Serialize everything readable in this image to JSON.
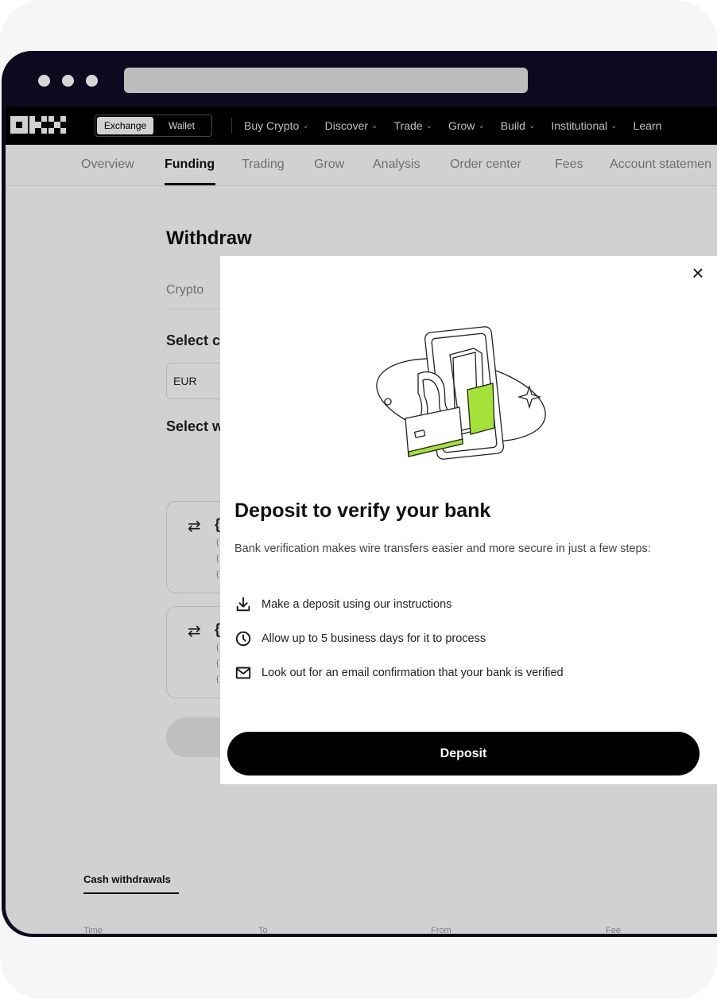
{
  "nav": {
    "mode_exchange": "Exchange",
    "mode_wallet": "Wallet",
    "menu": [
      {
        "label": "Buy Crypto",
        "dropdown": true
      },
      {
        "label": "Discover",
        "dropdown": true
      },
      {
        "label": "Trade",
        "dropdown": true
      },
      {
        "label": "Grow",
        "dropdown": true
      },
      {
        "label": "Build",
        "dropdown": true
      },
      {
        "label": "Institutional",
        "dropdown": true
      },
      {
        "label": "Learn",
        "dropdown": false
      }
    ]
  },
  "subnav": {
    "tabs": [
      "Overview",
      "Funding",
      "Trading",
      "Grow",
      "Analysis",
      "Order center",
      "Fees",
      "Account statemen"
    ],
    "active": "Funding"
  },
  "page": {
    "title": "Withdraw",
    "crypto_tab": "Crypto",
    "select_currency_label": "Select c",
    "currency_value": "EUR",
    "select_way_label": "Select w",
    "method_name_fragment": "{",
    "method_detail_fragments": [
      "{",
      "{",
      "{"
    ]
  },
  "history": {
    "tab": "Cash withdrawals",
    "columns": [
      "Time",
      "To",
      "From",
      "Fee"
    ]
  },
  "modal": {
    "title": "Deposit to verify your bank",
    "description": "Bank verification makes wire transfers easier and more secure in just a few steps:",
    "steps": [
      {
        "icon": "download-icon",
        "text": "Make a deposit using our instructions"
      },
      {
        "icon": "clock-icon",
        "text": "Allow up to 5 business days for it to process"
      },
      {
        "icon": "mail-icon",
        "text": "Look out for an email confirmation that your bank is verified"
      }
    ],
    "button": "Deposit"
  },
  "colors": {
    "accent_green": "#a4e23a",
    "primary_button": "#000000",
    "browser_frame": "#0c0a1e"
  }
}
